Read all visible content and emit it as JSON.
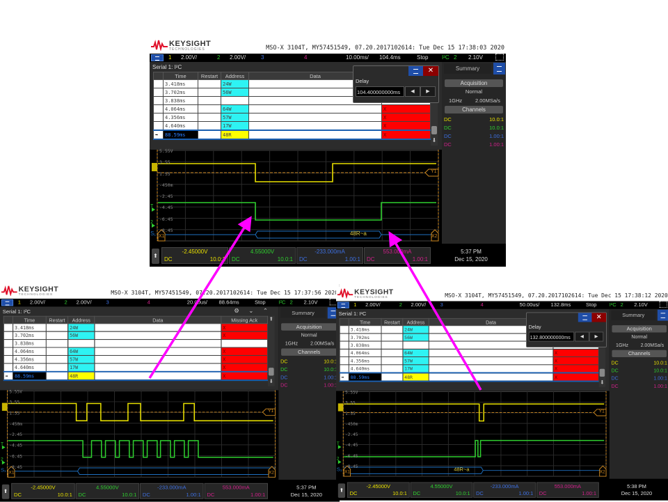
{
  "colors": {
    "ch1": "#e8e000",
    "ch2": "#2fd02f",
    "ch3": "#3d6fe0",
    "ch4": "#d0208a",
    "arrow": "#ff00ff",
    "missing_ack": "#ff0000",
    "address": "#2ef3f3",
    "selected_address": "#ffff00"
  },
  "scopes": [
    {
      "brand": {
        "name": "KEYSIGHT",
        "sub": "TECHNOLOGIES"
      },
      "title": "MSO-X 3104T, MY57451549, 07.20.2017102614: Tue Dec 15 17:38:03 2020",
      "toolbar": {
        "ch1": "1",
        "ch1_scale": "2.00V/",
        "ch2": "2",
        "ch2_scale": "2.00V/",
        "ch3": "3",
        "ch4": "4",
        "timebase": "10.00ms/",
        "delay": "104.4ms",
        "run_state": "Stop",
        "trigger_type": "I²C",
        "trigger_source": "2",
        "trigger_level": "2.10V"
      },
      "serial_label": "Serial 1: I²C",
      "table": {
        "columns": [
          "Time",
          "Restart",
          "Address",
          "Data",
          "Missing Ack"
        ],
        "rows": [
          {
            "time": "3.418ms",
            "address": "24W",
            "ack": "X"
          },
          {
            "time": "3.702ms",
            "address": "56W",
            "ack": "X"
          },
          {
            "time": "3.838ms",
            "address": "",
            "ack": ""
          },
          {
            "time": "4.064ms",
            "address": "64W",
            "ack": "X"
          },
          {
            "time": "4.356ms",
            "address": "57W",
            "ack": "X"
          },
          {
            "time": "4.640ms",
            "address": "17W",
            "ack": "X"
          },
          {
            "time": "88.59ms",
            "address": "48R",
            "ack": "X",
            "selected": true
          }
        ]
      },
      "delay_dialog": {
        "label": "Delay",
        "value": "104.400000000ms"
      },
      "summary": {
        "tab": "Summary",
        "acquisition": "Acquisition",
        "mode": "Normal",
        "bandwidth": "1GHz",
        "sample_rate": "2.00MSa/s",
        "channels": "Channels",
        "channel_rows": [
          {
            "coupling": "DC",
            "probe": "10.0:1"
          },
          {
            "coupling": "DC",
            "probe": "10.0:1"
          },
          {
            "coupling": "DC",
            "probe": "1.00:1"
          },
          {
            "coupling": "DC",
            "probe": "1.00:1"
          }
        ]
      },
      "wave": {
        "scale_labels": [
          "5.55V",
          "3.55",
          "1.55",
          "-450m",
          "-2.45",
          "-4.45",
          "-6.45",
          "-8.45"
        ],
        "decode_label": "48R~a",
        "markers": {
          "x1": "X1",
          "x2": "X2",
          "y1": "Y1"
        }
      },
      "channel_bar": [
        {
          "value": "-2.45000V",
          "coupling": "DC",
          "probe": "10.0:1"
        },
        {
          "value": "4.55000V",
          "coupling": "DC",
          "probe": "10.0:1"
        },
        {
          "value": "-233.000mA",
          "coupling": "DC",
          "probe": "1.00:1"
        },
        {
          "value": "553.000mA",
          "coupling": "DC",
          "probe": "1.00:1"
        }
      ],
      "clock": {
        "time": "5:37 PM",
        "date": "Dec 15, 2020"
      }
    },
    {
      "brand": {
        "name": "KEYSIGHT",
        "sub": "TECHNOLOGIES"
      },
      "title": "MSO-X 3104T, MY57451549, 07.20.2017102614: Tue Dec 15 17:37:56 2020",
      "toolbar": {
        "ch1": "1",
        "ch1_scale": "2.00V/",
        "ch2": "2",
        "ch2_scale": "2.00V/",
        "ch3": "3",
        "ch4": "4",
        "timebase": "20.00us/",
        "delay": "88.64ms",
        "run_state": "Stop",
        "trigger_type": "I²C",
        "trigger_source": "2",
        "trigger_level": "2.10V"
      },
      "serial_label": "Serial 1: I²C",
      "table": {
        "columns": [
          "Time",
          "Restart",
          "Address",
          "Data",
          "Missing Ack"
        ],
        "rows": [
          {
            "time": "3.418ms",
            "address": "24W",
            "ack": "X"
          },
          {
            "time": "3.702ms",
            "address": "56W",
            "ack": "X"
          },
          {
            "time": "3.838ms",
            "address": "",
            "ack": ""
          },
          {
            "time": "4.064ms",
            "address": "64W",
            "ack": "X"
          },
          {
            "time": "4.356ms",
            "address": "57W",
            "ack": "X"
          },
          {
            "time": "4.640ms",
            "address": "17W",
            "ack": "X"
          },
          {
            "time": "88.59ms",
            "address": "48R",
            "ack": "X",
            "selected": true
          }
        ]
      },
      "summary": {
        "tab": "Summary",
        "acquisition": "Acquisition",
        "mode": "Normal",
        "bandwidth": "1GHz",
        "sample_rate": "2.00MSa/s",
        "channels": "Channels",
        "channel_rows": [
          {
            "coupling": "DC",
            "probe": "10.0:1"
          },
          {
            "coupling": "DC",
            "probe": "10.0:1"
          },
          {
            "coupling": "DC",
            "probe": "1.00:1"
          },
          {
            "coupling": "DC",
            "probe": "1.00:1"
          }
        ]
      },
      "wave": {
        "scale_labels": [
          "5.55V",
          "3.55",
          "1.55",
          "-450m",
          "-2.45",
          "-4.45",
          "-6.45",
          "-8.45"
        ],
        "decode_label": "",
        "markers": {
          "x1": "X1",
          "x2": "X2",
          "y1": "Y1"
        }
      },
      "channel_bar": [
        {
          "value": "-2.45000V",
          "coupling": "DC",
          "probe": "10.0:1"
        },
        {
          "value": "4.55000V",
          "coupling": "DC",
          "probe": "10.0:1"
        },
        {
          "value": "-233.000mA",
          "coupling": "DC",
          "probe": "1.00:1"
        },
        {
          "value": "553.000mA",
          "coupling": "DC",
          "probe": "1.00:1"
        }
      ],
      "clock": {
        "time": "5:37 PM",
        "date": "Dec 15, 2020"
      }
    },
    {
      "brand": {
        "name": "KEYSIGHT",
        "sub": "TECHNOLOGIES"
      },
      "title": "MSO-X 3104T, MY57451549, 07.20.2017102614: Tue Dec 15 17:38:12 2020",
      "toolbar": {
        "ch1": "1",
        "ch1_scale": "2.00V/",
        "ch2": "2",
        "ch2_scale": "2.00V/",
        "ch3": "3",
        "ch4": "4",
        "timebase": "50.00us/",
        "delay": "132.8ms",
        "run_state": "Stop",
        "trigger_type": "I²C",
        "trigger_source": "2",
        "trigger_level": "2.10V"
      },
      "serial_label": "Serial 1: I²C",
      "table": {
        "columns": [
          "Time",
          "Restart",
          "Address",
          "Data",
          "Missing Ack"
        ],
        "rows": [
          {
            "time": "3.418ms",
            "address": "24W",
            "ack": "X"
          },
          {
            "time": "3.702ms",
            "address": "56W",
            "ack": "X"
          },
          {
            "time": "3.838ms",
            "address": "",
            "ack": ""
          },
          {
            "time": "4.064ms",
            "address": "64W",
            "ack": "X"
          },
          {
            "time": "4.356ms",
            "address": "57W",
            "ack": "X"
          },
          {
            "time": "4.640ms",
            "address": "17W",
            "ack": "X"
          },
          {
            "time": "88.59ms",
            "address": "48R",
            "ack": "X",
            "selected": true
          }
        ]
      },
      "delay_dialog": {
        "label": "Delay",
        "value": "132.800000000ms"
      },
      "summary": {
        "tab": "Summary",
        "acquisition": "Acquisition",
        "mode": "Normal",
        "bandwidth": "1GHz",
        "sample_rate": "2.00MSa/s",
        "channels": "Channels",
        "channel_rows": [
          {
            "coupling": "DC",
            "probe": "10.0:1"
          },
          {
            "coupling": "DC",
            "probe": "10.0:1"
          },
          {
            "coupling": "DC",
            "probe": "1.00:1"
          },
          {
            "coupling": "DC",
            "probe": "1.00:1"
          }
        ]
      },
      "wave": {
        "scale_labels": [
          "5.55V",
          "3.55",
          "1.55",
          "-450m",
          "-2.45",
          "-4.45",
          "-6.45",
          "-8.45"
        ],
        "decode_label": "48R~a",
        "markers": {
          "x1": "X1",
          "x2": "X2",
          "y1": "Y1"
        }
      },
      "channel_bar": [
        {
          "value": "-2.45000V",
          "coupling": "DC",
          "probe": "10.0:1"
        },
        {
          "value": "4.55000V",
          "coupling": "DC",
          "probe": "10.0:1"
        },
        {
          "value": "-233.000mA",
          "coupling": "DC",
          "probe": "1.00:1"
        },
        {
          "value": "553.000mA",
          "coupling": "DC",
          "probe": "1.00:1"
        }
      ],
      "clock": {
        "time": "5:38 PM",
        "date": "Dec 15, 2020"
      }
    }
  ]
}
